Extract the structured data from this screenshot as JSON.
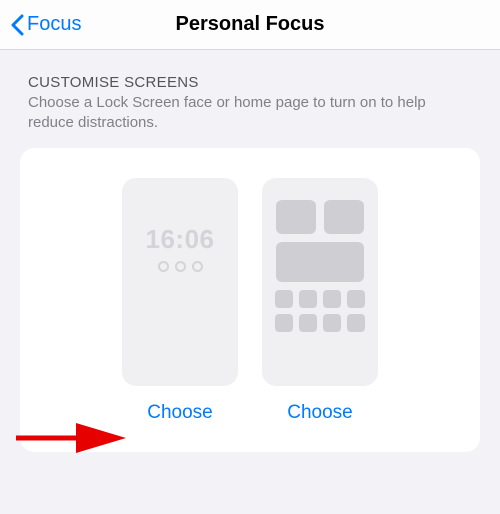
{
  "header": {
    "back_label": "Focus",
    "title": "Personal Focus"
  },
  "section": {
    "label": "CUSTOMISE SCREENS",
    "description": "Choose a Lock Screen face or home page to turn on to help reduce distractions."
  },
  "previews": {
    "lock_time": "16:06",
    "choose_label_1": "Choose",
    "choose_label_2": "Choose"
  }
}
